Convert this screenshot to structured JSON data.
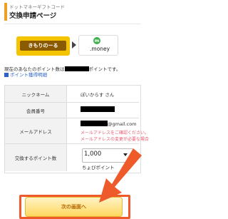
{
  "header": {
    "subtitle": "ドットマネーギフトコード",
    "title": "交換申請ページ"
  },
  "logos": {
    "left_brand": "きもりのーる",
    "right_brand_mark": "m",
    "right_brand_text": ".money"
  },
  "points": {
    "prefix": "現在のあなたのポイント数は",
    "suffix": "ポイントです。",
    "link": "ポイント獲得明細"
  },
  "form": {
    "nickname_label": "ニックネーム",
    "nickname_value": "ぽいからす さん",
    "member_label": "会員番号",
    "email_label": "メールアドレス",
    "email_domain": "@gmail.com",
    "email_note_1": "メールアドレスをご確認ください。",
    "email_note_2": "メールアドレスの変更が必要な場合",
    "exchange_label": "交換するポイント数",
    "exchange_value": "1,000",
    "exchange_unit": "ちょびポイント"
  },
  "next_button": "次の画面へ",
  "colors": {
    "accent": "#f0a020",
    "link": "#2b63c4",
    "note": "#e8596e",
    "highlight": "#ee5a2a",
    "button_bg": "#ffd860"
  }
}
